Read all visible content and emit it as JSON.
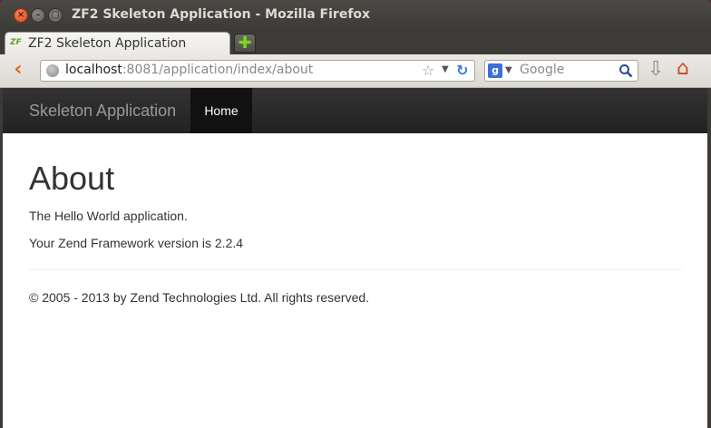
{
  "window": {
    "title": "ZF2 Skeleton Application - Mozilla Firefox"
  },
  "tabs": [
    {
      "label": "ZF2 Skeleton Application",
      "favicon_text": "ZF"
    }
  ],
  "browser": {
    "new_tab_symbol": "✚",
    "url_host": "localhost",
    "url_rest": ":8081/application/index/about",
    "search_placeholder": "Google",
    "search_engine_letter": "g"
  },
  "site": {
    "brand": "Skeleton Application",
    "nav_items": [
      {
        "label": "Home",
        "active": true
      }
    ]
  },
  "page": {
    "heading": "About",
    "paragraphs": [
      "The Hello World application.",
      "Your Zend Framework version is 2.2.4"
    ],
    "footer": "© 2005 - 2013 by Zend Technologies Ltd. All rights reserved."
  },
  "colors": {
    "accent_back": "#e2661a",
    "navbar_bg": "#222222",
    "new_tab_plus": "#7ed321"
  },
  "icons": [
    "close-icon",
    "minimize-icon",
    "maximize-icon",
    "back-icon",
    "globe-icon",
    "star-icon",
    "reload-icon",
    "search-icon",
    "download-icon",
    "home-icon"
  ]
}
